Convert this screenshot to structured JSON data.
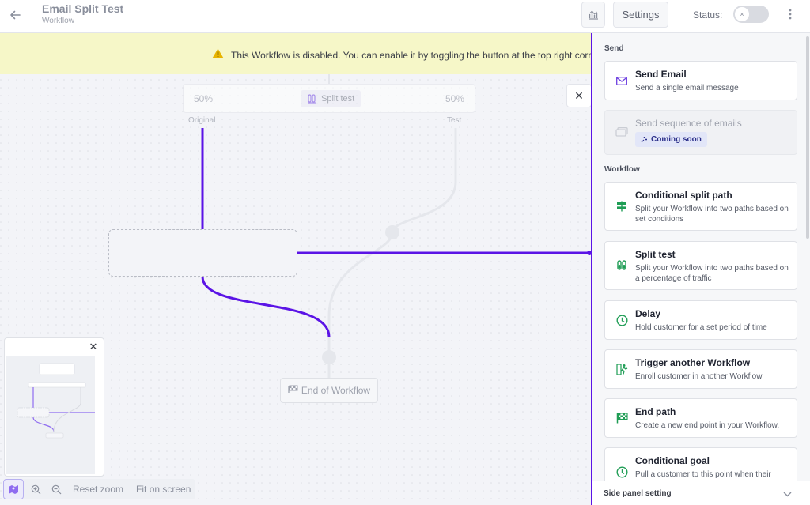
{
  "header": {
    "title": "Email Split Test",
    "subtitle": "Workflow",
    "settings_label": "Settings",
    "status_label": "Status:",
    "status_enabled": false
  },
  "banner": {
    "text": "This Workflow is disabled. You can enable it by toggling the button at the top right corner"
  },
  "canvas": {
    "split_node": {
      "left_percent": "50%",
      "label": "Split test",
      "right_percent": "50%",
      "left_branch": "Original",
      "right_branch": "Test"
    },
    "end_node_label": "End of Workflow"
  },
  "zoom": {
    "reset_label": "Reset zoom",
    "fit_label": "Fit on screen"
  },
  "side_panel": {
    "send_heading": "Send",
    "send_items": [
      {
        "title": "Send Email",
        "description": "Send a single email message",
        "icon": "envelope-icon"
      },
      {
        "title": "Send sequence of emails",
        "badge": "Coming soon",
        "icon": "email-sequence-icon",
        "disabled": true
      }
    ],
    "workflow_heading": "Workflow",
    "workflow_items": [
      {
        "title": "Conditional split path",
        "description": "Split your Workflow into two paths based on set conditions",
        "icon": "signpost-icon"
      },
      {
        "title": "Split test",
        "description": "Split your Workflow into two paths based on a percentage of traffic",
        "icon": "test-tubes-icon"
      },
      {
        "title": "Delay",
        "description": "Hold customer for a set period of time",
        "icon": "clock-icon"
      },
      {
        "title": "Trigger another Workflow",
        "description": "Enroll customer in another Workflow",
        "icon": "running-person-icon"
      },
      {
        "title": "End path",
        "description": "Create a new end point in your Workflow.",
        "icon": "flag-icon"
      },
      {
        "title": "Conditional goal",
        "description": "Pull a customer to this point when their",
        "icon": "goal-clock-icon"
      }
    ],
    "footer_label": "Side panel setting"
  },
  "colors": {
    "accent": "#5b14e6",
    "banner_bg": "#f6f7c8",
    "icon_green": "#1f9d55",
    "icon_purple": "#6d3fe0"
  }
}
